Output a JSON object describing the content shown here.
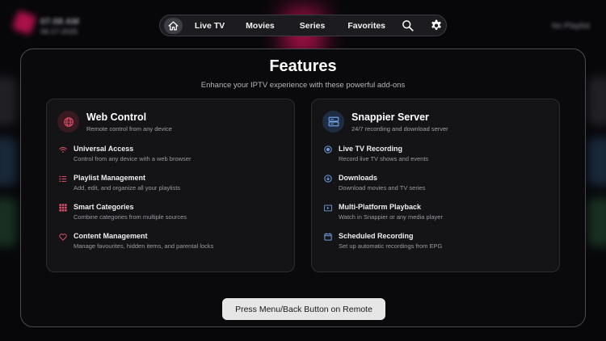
{
  "background": {
    "clock_time": "07:08 AM",
    "clock_date": "06-17-2025",
    "right_label": "No Playlist"
  },
  "nav": {
    "items": [
      {
        "label": "Live TV"
      },
      {
        "label": "Movies"
      },
      {
        "label": "Series"
      },
      {
        "label": "Favorites"
      }
    ],
    "icons": [
      "home-icon",
      "search-icon",
      "gear-icon"
    ]
  },
  "modal": {
    "title": "Features",
    "subtitle": "Enhance your IPTV experience with these powerful add-ons",
    "panels": [
      {
        "title": "Web Control",
        "subtitle": "Remote control from any device",
        "icon": "globe-icon",
        "accent": "#e0506a",
        "features": [
          {
            "title": "Universal Access",
            "desc": "Control from any device with a web browser",
            "icon": "wifi-icon"
          },
          {
            "title": "Playlist Management",
            "desc": "Add, edit, and organize all your playlists",
            "icon": "list-icon"
          },
          {
            "title": "Smart Categories",
            "desc": "Combine categories from multiple sources",
            "icon": "grid-icon"
          },
          {
            "title": "Content Management",
            "desc": "Manage favourites, hidden items, and parental locks",
            "icon": "heart-icon"
          }
        ]
      },
      {
        "title": "Snappier Server",
        "subtitle": "24/7 recording and download server",
        "icon": "server-icon",
        "accent": "#6f9fe0",
        "features": [
          {
            "title": "Live TV Recording",
            "desc": "Record live TV shows and events",
            "icon": "record-icon"
          },
          {
            "title": "Downloads",
            "desc": "Download movies and TV series",
            "icon": "download-icon"
          },
          {
            "title": "Multi-Platform Playback",
            "desc": "Watch in Snappier or any media player",
            "icon": "play-icon"
          },
          {
            "title": "Scheduled Recording",
            "desc": "Set up automatic recordings from EPG",
            "icon": "calendar-icon"
          }
        ]
      }
    ],
    "button_label": "Press Menu/Back Button on Remote"
  }
}
